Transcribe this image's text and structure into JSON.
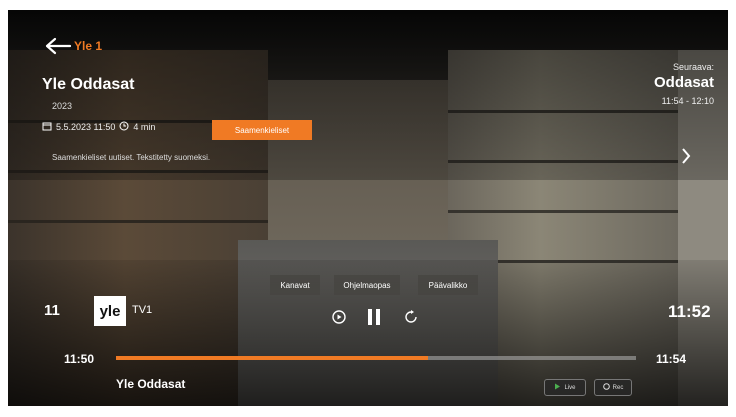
{
  "header": {
    "channel_name": "Yle 1",
    "title": "Yle Oddasat",
    "year": "2023",
    "date_time": "5.5.2023 11:50",
    "duration": "4 min",
    "tag_button": "Saamenkieliset",
    "subtitle_line": "Saamenkieliset uutiset. Tekstitetty suomeksi."
  },
  "next_program": {
    "label": "Seuraava:",
    "title": "Oddasat",
    "time": "11:54 - 12:10"
  },
  "menu": {
    "items": [
      "Kanavat",
      "Ohjelmaopas",
      "Päävalikko"
    ]
  },
  "player": {
    "channel_number": "11",
    "logo_text": "yle",
    "logo_channel": "TV1",
    "current_clock": "11:52",
    "start_time": "11:50",
    "end_time": "11:54",
    "progress_percent": 60,
    "program_title": "Yle Oddasat",
    "live_label": "Live",
    "rec_label": "Rec"
  },
  "colors": {
    "accent": "#f07a24",
    "text": "#ffffff"
  },
  "icons": [
    "back-arrow-icon",
    "calendar-icon",
    "clock-icon",
    "chevron-right-icon",
    "replay-icon",
    "pause-icon",
    "restart-icon",
    "play-icon",
    "record-icon"
  ]
}
